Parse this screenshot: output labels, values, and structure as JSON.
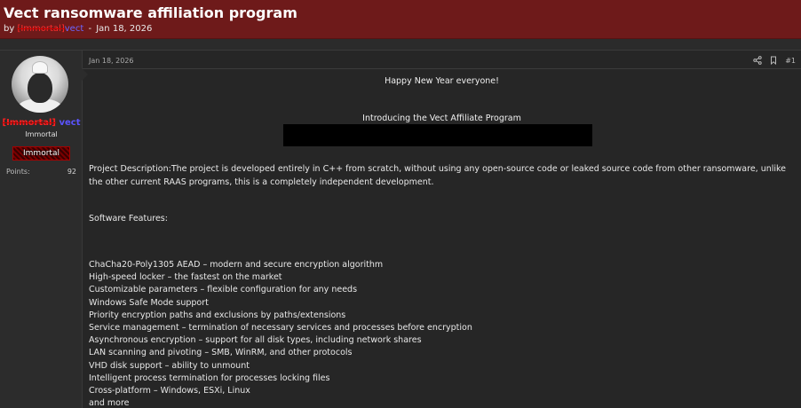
{
  "thread": {
    "title": "Vect ransomware affiliation program",
    "by_prefix": "by",
    "author_rank": "[Immortal]",
    "author_name": "vect",
    "date_separator": "-",
    "date": "Jan 18, 2026"
  },
  "user": {
    "rank": "[Immortal]",
    "name": "vect",
    "title": "Immortal",
    "banner": "Immortal",
    "points_label": "Points:",
    "points_value": "92"
  },
  "post": {
    "date": "Jan 18, 2026",
    "number": "#1",
    "greeting": "Happy New Year everyone!",
    "intro": "Introducing the Vect Affiliate Program",
    "description": "Project Description:The project is developed entirely in C++ from scratch, without using any open-source code or leaked source code from other ransomware, unlike the other current RAAS programs, this is a completely independent development.",
    "features_heading": "Software Features:",
    "features": [
      "ChaCha20-Poly1305 AEAD – modern and secure encryption algorithm",
      "High-speed locker – the fastest on the market",
      "Customizable parameters – flexible configuration for any needs",
      "Windows Safe Mode support",
      "Priority encryption paths and exclusions by paths/extensions",
      "Service management – termination of necessary services and processes before encryption",
      "Asynchronous encryption – support for all disk types, including network shares",
      "LAN scanning and pivoting – SMB, WinRM, and other protocols",
      "VHD disk support – ability to unmount",
      "Intelligent process termination for processes locking files",
      "Cross-platform – Windows, ESXi, Linux",
      "and more"
    ]
  },
  "icons": {
    "share": "share-icon",
    "bookmark": "bookmark-icon"
  },
  "colors": {
    "header_bg": "#6e1a1a",
    "rank": "#ff2020",
    "username": "#5b54ff",
    "page_bg": "#262626"
  }
}
